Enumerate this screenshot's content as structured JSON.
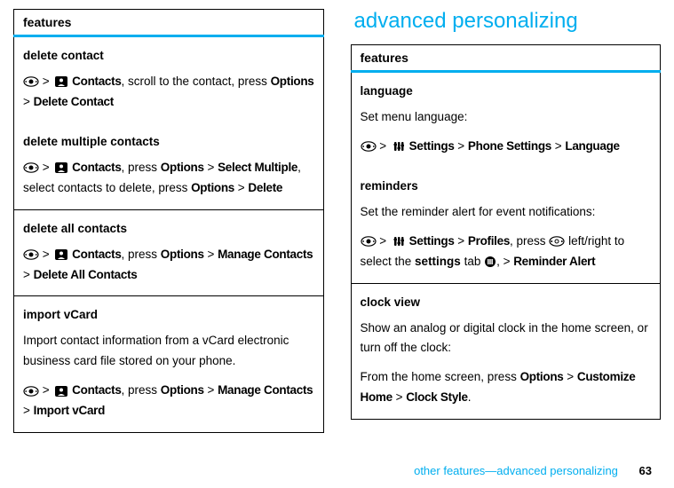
{
  "left": {
    "header": "features",
    "rows": [
      {
        "title": "delete contact",
        "pre": "",
        "path": [
          {
            "t": "nav"
          },
          {
            "t": "gt"
          },
          {
            "t": "contacts-icon"
          },
          {
            "t": "cond",
            "v": "Contacts"
          },
          {
            "t": "text",
            "v": ", scroll to the contact, press "
          },
          {
            "t": "cond",
            "v": "Options"
          },
          {
            "t": "text",
            "v": " > "
          },
          {
            "t": "cond",
            "v": "Delete Contact"
          }
        ]
      },
      {
        "title": "delete multiple contacts",
        "pre": "",
        "path": [
          {
            "t": "nav"
          },
          {
            "t": "gt"
          },
          {
            "t": "contacts-icon"
          },
          {
            "t": "cond",
            "v": "Contacts"
          },
          {
            "t": "text",
            "v": ", press "
          },
          {
            "t": "cond",
            "v": "Options"
          },
          {
            "t": "text",
            "v": " > "
          },
          {
            "t": "cond",
            "v": "Select Multiple"
          },
          {
            "t": "text",
            "v": ", select contacts to delete, press "
          },
          {
            "t": "cond",
            "v": "Options"
          },
          {
            "t": "text",
            "v": " > "
          },
          {
            "t": "cond",
            "v": "Delete"
          }
        ]
      },
      {
        "title": "delete all contacts",
        "pre": "",
        "path": [
          {
            "t": "nav"
          },
          {
            "t": "gt"
          },
          {
            "t": "contacts-icon"
          },
          {
            "t": "cond",
            "v": "Contacts"
          },
          {
            "t": "text",
            "v": ", press "
          },
          {
            "t": "cond",
            "v": "Options"
          },
          {
            "t": "text",
            "v": " > "
          },
          {
            "t": "cond",
            "v": "Manage Contacts"
          },
          {
            "t": "text",
            "v": " > "
          },
          {
            "t": "cond",
            "v": "Delete All Contacts"
          }
        ]
      },
      {
        "title": "import vCard",
        "pre": "Import contact information from a vCard electronic business card file stored on your phone.",
        "path": [
          {
            "t": "nav"
          },
          {
            "t": "gt"
          },
          {
            "t": "contacts-icon"
          },
          {
            "t": "cond",
            "v": "Contacts"
          },
          {
            "t": "text",
            "v": ", press "
          },
          {
            "t": "cond",
            "v": "Options"
          },
          {
            "t": "text",
            "v": " > "
          },
          {
            "t": "cond",
            "v": "Manage Contacts"
          },
          {
            "t": "text",
            "v": " > "
          },
          {
            "t": "cond",
            "v": "Import vCard"
          }
        ]
      }
    ]
  },
  "right": {
    "section": "advanced personalizing",
    "header": "features",
    "rows": [
      {
        "title": "language",
        "pre": "Set menu language:",
        "path": [
          {
            "t": "nav"
          },
          {
            "t": "gt"
          },
          {
            "t": "settings-icon"
          },
          {
            "t": "cond",
            "v": "Settings"
          },
          {
            "t": "text",
            "v": " > "
          },
          {
            "t": "cond",
            "v": "Phone Settings"
          },
          {
            "t": "text",
            "v": " > "
          },
          {
            "t": "cond",
            "v": "Language"
          }
        ]
      },
      {
        "title": "reminders",
        "pre": "Set the reminder alert for event notifications:",
        "path": [
          {
            "t": "nav"
          },
          {
            "t": "gt"
          },
          {
            "t": "settings-icon"
          },
          {
            "t": "cond",
            "v": "Settings"
          },
          {
            "t": "text",
            "v": " > "
          },
          {
            "t": "cond",
            "v": "Profiles"
          },
          {
            "t": "text",
            "v": ", press "
          },
          {
            "t": "navlr"
          },
          {
            "t": "text",
            "v": " left/right to select the "
          },
          {
            "t": "bold",
            "v": "settings"
          },
          {
            "t": "text",
            "v": " tab "
          },
          {
            "t": "tab-icon"
          },
          {
            "t": "text",
            "v": ", > "
          },
          {
            "t": "cond",
            "v": "Reminder Alert"
          }
        ]
      },
      {
        "title": "clock view",
        "pre": "Show an analog or digital clock in the home screen, or turn off the clock:",
        "path": [
          {
            "t": "text",
            "v": "From the home screen, press "
          },
          {
            "t": "cond",
            "v": "Options"
          },
          {
            "t": "text",
            "v": " > "
          },
          {
            "t": "cond",
            "v": "Customize Home"
          },
          {
            "t": "text",
            "v": " > "
          },
          {
            "t": "cond",
            "v": "Clock Style"
          },
          {
            "t": "text",
            "v": "."
          }
        ]
      }
    ]
  },
  "footer": {
    "text": "other features—advanced personalizing",
    "page": "63"
  }
}
